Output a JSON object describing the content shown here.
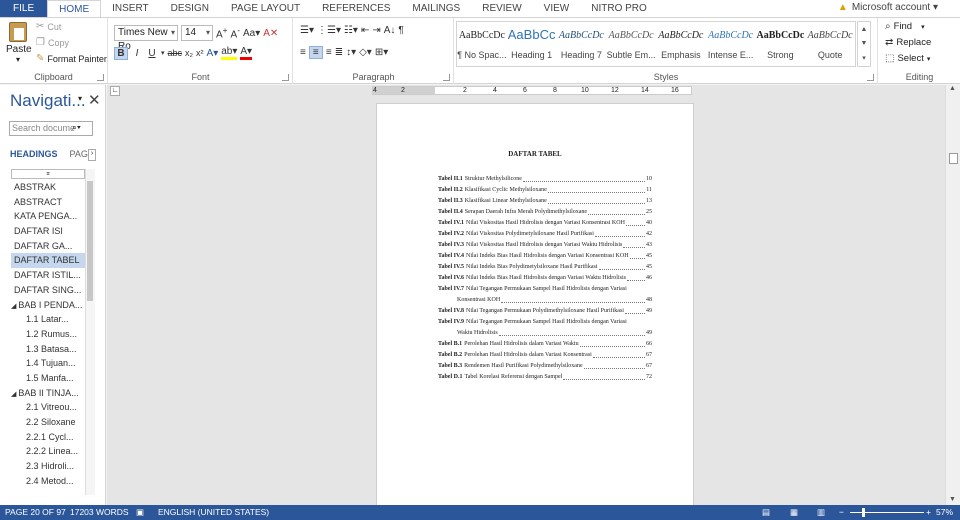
{
  "tabs": [
    "FILE",
    "HOME",
    "INSERT",
    "DESIGN",
    "PAGE LAYOUT",
    "REFERENCES",
    "MAILINGS",
    "REVIEW",
    "VIEW",
    "NITRO PRO"
  ],
  "account": "Microsoft account",
  "clipboard": {
    "cut": "Cut",
    "copy": "Copy",
    "paste": "Paste",
    "format_painter": "Format Painter",
    "label": "Clipboard"
  },
  "font": {
    "family": "Times New Ro",
    "size": "14",
    "label": "Font"
  },
  "paragraph": {
    "label": "Paragraph"
  },
  "styles": {
    "label": "Styles",
    "items": [
      {
        "preview": "AaBbCcDc",
        "name": "¶ No Spac..."
      },
      {
        "preview": "AaBbCc",
        "name": "Heading 1"
      },
      {
        "preview": "AaBbCcDc",
        "name": "Heading 7"
      },
      {
        "preview": "AaBbCcDc",
        "name": "Subtle Em..."
      },
      {
        "preview": "AaBbCcDc",
        "name": "Emphasis"
      },
      {
        "preview": "AaBbCcDc",
        "name": "Intense E..."
      },
      {
        "preview": "AaBbCcDc",
        "name": "Strong"
      },
      {
        "preview": "AaBbCcDc",
        "name": "Quote"
      }
    ]
  },
  "editing": {
    "find": "Find",
    "replace": "Replace",
    "select": "Select",
    "label": "Editing"
  },
  "nav": {
    "title": "Navigati...",
    "search_placeholder": "Search docume",
    "tab_headings": "HEADINGS",
    "tab_pages": "PAG",
    "items": [
      "ABSTRAK",
      "ABSTRACT",
      "KATA PENGA...",
      "DAFTAR ISI",
      "DAFTAR GA...",
      "DAFTAR TABEL",
      "DAFTAR ISTIL...",
      "DAFTAR SING...",
      "BAB I PENDA...",
      "1.1  Latar...",
      "1.2 Rumus...",
      "1.3 Batasa...",
      "1.4 Tujuan...",
      "1.5 Manfa...",
      "BAB II TINJA...",
      "2.1 Vitreou...",
      "2.2 Siloxane",
      "2.2.1 Cycl...",
      "2.2.2 Linea...",
      "2.3 Hidroli...",
      "2.4 Metod..."
    ]
  },
  "ruler": {
    "ticks": [
      "4",
      "2",
      "2",
      "4",
      "6",
      "8",
      "10",
      "12",
      "14",
      "16"
    ]
  },
  "document": {
    "title": "DAFTAR TABEL",
    "entries": [
      {
        "label": "Tabel II.1",
        "text": "Struktur Methylsilicone",
        "page": "10"
      },
      {
        "label": "Tabel II.2",
        "text": "Klasifikasi Cyclic Methylsiloxane",
        "page": "11"
      },
      {
        "label": "Tabel II.3",
        "text": "Klasifikasi Linear Methylsiloxane",
        "page": "13"
      },
      {
        "label": "Tabel II.4",
        "text": "Serapan Daerah Infra Merah Polydimethylsiloxane",
        "page": "25"
      },
      {
        "label": "Tabel IV.1",
        "text": "Nilai Viskositas Hasil Hidrolisis dengan Variasi Konsentrasi KOH",
        "page": "40"
      },
      {
        "label": "Tabel IV.2",
        "text": "Nilai Viskositas Polydimetylsiloxane Hasil Purifikasi",
        "page": "42"
      },
      {
        "label": "Tabel IV.3",
        "text": "Nilai Viskositas Hasil Hidrolisis dengan Variasi Waktu Hidrolisis",
        "page": "43"
      },
      {
        "label": "Tabel IV.4",
        "text": "Nilai Indeks Bias Hasil Hidrolisis dengan Variasi Konsentrasi KOH",
        "page": "45"
      },
      {
        "label": "Tabel IV.5",
        "text": "Nilai Indeks Bias Polydimetylsiloxane Hasil Purifikasi",
        "page": "45"
      },
      {
        "label": "Tabel IV.6",
        "text": "Nilai Indeks Bias Hasil Hidrolisis dengan Variasi Waktu Hidrolisis",
        "page": "46"
      },
      {
        "label": "Tabel IV.7",
        "text": "Nilai Tegangan Permukaan Sampel Hasil Hidrolisis dengan Variasi",
        "cont": "Konsentrasi KOH",
        "page": "48"
      },
      {
        "label": "Tabel IV.8",
        "text": "Nilai Tegangan Permukaan Polydimethylsiloxane Hasil Purifikasi",
        "page": "49"
      },
      {
        "label": "Tabel IV.9",
        "text": "Nilai Tegangan Permukaan Sampel Hasil Hidrolisis dengan Variasi",
        "cont": "Waktu Hidrolisis",
        "page": "49"
      },
      {
        "label": "Tabel B.1",
        "text": "Perolehan Hasil Hidrolisis dalam Variasi Waktu",
        "page": "66"
      },
      {
        "label": "Tabel B.2",
        "text": "Perolehan Hasil Hidrolisis dalam Variasi Konsentrasi",
        "page": "67"
      },
      {
        "label": "Tabel B.3",
        "text": "Rendemen Hasil Purifikasi Polydimethylsiloxane",
        "page": "67"
      },
      {
        "label": "Tabel D.1",
        "text": "Tabel Korelasi Referensi dengan Sampel",
        "page": "72"
      }
    ]
  },
  "status": {
    "page": "PAGE 20 OF 97",
    "words": "17203 WORDS",
    "language": "ENGLISH (UNITED STATES)",
    "zoom": "57%"
  },
  "colors": {
    "accent": "#2b579a",
    "selection": "#c5d7ee"
  }
}
